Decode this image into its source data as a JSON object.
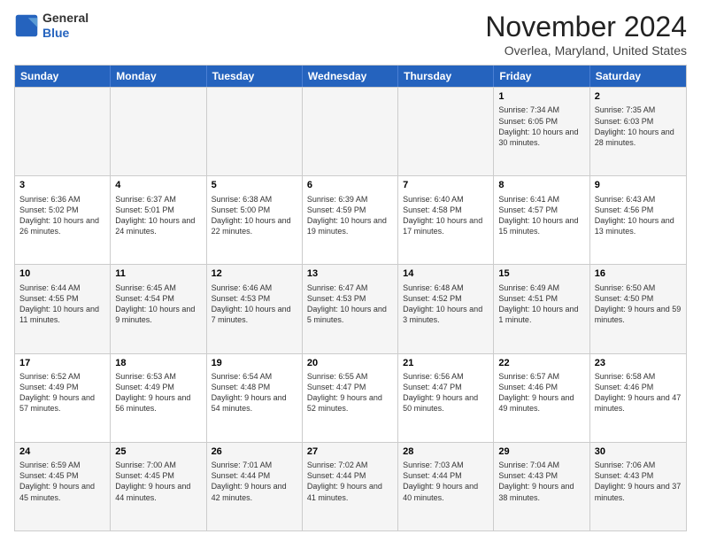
{
  "logo": {
    "general": "General",
    "blue": "Blue"
  },
  "title": "November 2024",
  "subtitle": "Overlea, Maryland, United States",
  "days": [
    "Sunday",
    "Monday",
    "Tuesday",
    "Wednesday",
    "Thursday",
    "Friday",
    "Saturday"
  ],
  "rows": [
    [
      {
        "day": "",
        "info": ""
      },
      {
        "day": "",
        "info": ""
      },
      {
        "day": "",
        "info": ""
      },
      {
        "day": "",
        "info": ""
      },
      {
        "day": "",
        "info": ""
      },
      {
        "day": "1",
        "info": "Sunrise: 7:34 AM\nSunset: 6:05 PM\nDaylight: 10 hours and 30 minutes."
      },
      {
        "day": "2",
        "info": "Sunrise: 7:35 AM\nSunset: 6:03 PM\nDaylight: 10 hours and 28 minutes."
      }
    ],
    [
      {
        "day": "3",
        "info": "Sunrise: 6:36 AM\nSunset: 5:02 PM\nDaylight: 10 hours and 26 minutes."
      },
      {
        "day": "4",
        "info": "Sunrise: 6:37 AM\nSunset: 5:01 PM\nDaylight: 10 hours and 24 minutes."
      },
      {
        "day": "5",
        "info": "Sunrise: 6:38 AM\nSunset: 5:00 PM\nDaylight: 10 hours and 22 minutes."
      },
      {
        "day": "6",
        "info": "Sunrise: 6:39 AM\nSunset: 4:59 PM\nDaylight: 10 hours and 19 minutes."
      },
      {
        "day": "7",
        "info": "Sunrise: 6:40 AM\nSunset: 4:58 PM\nDaylight: 10 hours and 17 minutes."
      },
      {
        "day": "8",
        "info": "Sunrise: 6:41 AM\nSunset: 4:57 PM\nDaylight: 10 hours and 15 minutes."
      },
      {
        "day": "9",
        "info": "Sunrise: 6:43 AM\nSunset: 4:56 PM\nDaylight: 10 hours and 13 minutes."
      }
    ],
    [
      {
        "day": "10",
        "info": "Sunrise: 6:44 AM\nSunset: 4:55 PM\nDaylight: 10 hours and 11 minutes."
      },
      {
        "day": "11",
        "info": "Sunrise: 6:45 AM\nSunset: 4:54 PM\nDaylight: 10 hours and 9 minutes."
      },
      {
        "day": "12",
        "info": "Sunrise: 6:46 AM\nSunset: 4:53 PM\nDaylight: 10 hours and 7 minutes."
      },
      {
        "day": "13",
        "info": "Sunrise: 6:47 AM\nSunset: 4:53 PM\nDaylight: 10 hours and 5 minutes."
      },
      {
        "day": "14",
        "info": "Sunrise: 6:48 AM\nSunset: 4:52 PM\nDaylight: 10 hours and 3 minutes."
      },
      {
        "day": "15",
        "info": "Sunrise: 6:49 AM\nSunset: 4:51 PM\nDaylight: 10 hours and 1 minute."
      },
      {
        "day": "16",
        "info": "Sunrise: 6:50 AM\nSunset: 4:50 PM\nDaylight: 9 hours and 59 minutes."
      }
    ],
    [
      {
        "day": "17",
        "info": "Sunrise: 6:52 AM\nSunset: 4:49 PM\nDaylight: 9 hours and 57 minutes."
      },
      {
        "day": "18",
        "info": "Sunrise: 6:53 AM\nSunset: 4:49 PM\nDaylight: 9 hours and 56 minutes."
      },
      {
        "day": "19",
        "info": "Sunrise: 6:54 AM\nSunset: 4:48 PM\nDaylight: 9 hours and 54 minutes."
      },
      {
        "day": "20",
        "info": "Sunrise: 6:55 AM\nSunset: 4:47 PM\nDaylight: 9 hours and 52 minutes."
      },
      {
        "day": "21",
        "info": "Sunrise: 6:56 AM\nSunset: 4:47 PM\nDaylight: 9 hours and 50 minutes."
      },
      {
        "day": "22",
        "info": "Sunrise: 6:57 AM\nSunset: 4:46 PM\nDaylight: 9 hours and 49 minutes."
      },
      {
        "day": "23",
        "info": "Sunrise: 6:58 AM\nSunset: 4:46 PM\nDaylight: 9 hours and 47 minutes."
      }
    ],
    [
      {
        "day": "24",
        "info": "Sunrise: 6:59 AM\nSunset: 4:45 PM\nDaylight: 9 hours and 45 minutes."
      },
      {
        "day": "25",
        "info": "Sunrise: 7:00 AM\nSunset: 4:45 PM\nDaylight: 9 hours and 44 minutes."
      },
      {
        "day": "26",
        "info": "Sunrise: 7:01 AM\nSunset: 4:44 PM\nDaylight: 9 hours and 42 minutes."
      },
      {
        "day": "27",
        "info": "Sunrise: 7:02 AM\nSunset: 4:44 PM\nDaylight: 9 hours and 41 minutes."
      },
      {
        "day": "28",
        "info": "Sunrise: 7:03 AM\nSunset: 4:44 PM\nDaylight: 9 hours and 40 minutes."
      },
      {
        "day": "29",
        "info": "Sunrise: 7:04 AM\nSunset: 4:43 PM\nDaylight: 9 hours and 38 minutes."
      },
      {
        "day": "30",
        "info": "Sunrise: 7:06 AM\nSunset: 4:43 PM\nDaylight: 9 hours and 37 minutes."
      }
    ]
  ]
}
